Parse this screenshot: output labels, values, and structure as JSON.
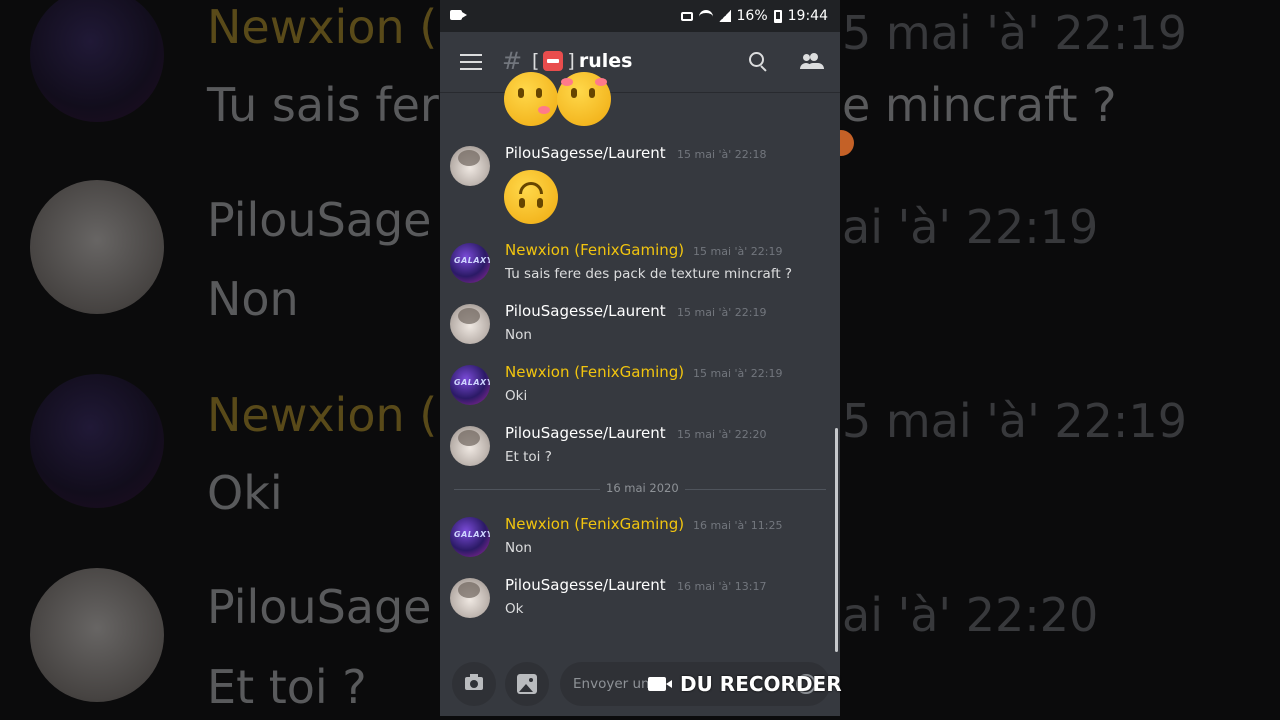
{
  "statusbar": {
    "battery": "16%",
    "time": "19:44"
  },
  "channel": {
    "hash": "#",
    "bracket_left": "[",
    "name": "rules",
    "bracket_right": "]"
  },
  "messages": [
    {
      "author": "PilouSagesse/Laurent",
      "timestamp": "15 mai 'à' 22:18",
      "text": "",
      "author_color": "#ffffff"
    },
    {
      "author": "Newxion (FenixGaming)",
      "timestamp": "15 mai 'à' 22:19",
      "text": "Tu sais fere des pack de texture mincraft ?",
      "author_color": "#f1c40f"
    },
    {
      "author": "PilouSagesse/Laurent",
      "timestamp": "15 mai 'à' 22:19",
      "text": "Non",
      "author_color": "#ffffff"
    },
    {
      "author": "Newxion (FenixGaming)",
      "timestamp": "15 mai 'à' 22:19",
      "text": "Oki",
      "author_color": "#f1c40f"
    },
    {
      "author": "PilouSagesse/Laurent",
      "timestamp": "15 mai 'à' 22:20",
      "text": "Et toi ?",
      "author_color": "#ffffff"
    },
    {
      "author": "Newxion (FenixGaming)",
      "timestamp": "16 mai 'à' 11:25",
      "text": "Non",
      "author_color": "#f1c40f"
    },
    {
      "author": "PilouSagesse/Laurent",
      "timestamp": "16 mai 'à' 13:17",
      "text": "Ok",
      "author_color": "#ffffff"
    }
  ],
  "date_divider": "16 mai 2020",
  "composer": {
    "placeholder": "Envoyer un"
  },
  "watermark": "DU RECORDER",
  "background": {
    "texts": [
      "Newxion (",
      "5 mai 'à' 22:19",
      "Tu sais fere",
      "e mincraft ?",
      "PilouSage",
      "ai 'à' 22:19",
      "Non",
      "Newxion (",
      "5 mai 'à' 22:19",
      "Oki",
      "PilouSage",
      "ai 'à' 22:20",
      "Et toi ?"
    ]
  },
  "colors": {
    "discord_bg": "#36393f",
    "status_bar": "#202225",
    "author_yellow": "#f1c40f",
    "timestamp": "#72767d"
  }
}
